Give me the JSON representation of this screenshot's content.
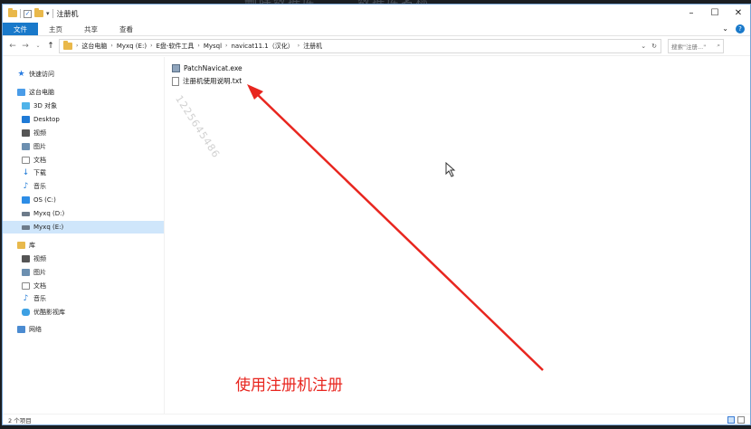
{
  "window": {
    "title": "注册机"
  },
  "ribbon": {
    "tabs": [
      {
        "label": "文件"
      },
      {
        "label": "主页"
      },
      {
        "label": "共享"
      },
      {
        "label": "查看"
      }
    ]
  },
  "address": {
    "crumbs": [
      "这台电脑",
      "Myxq (E:)",
      "E盘-软件工具",
      "Mysql",
      "navicat11.1（汉化）",
      "注册机"
    ],
    "search_placeholder": "搜索\"注册...\""
  },
  "nav_pane": {
    "items": [
      {
        "label": "快速访问",
        "icon": "star-icon"
      },
      {
        "label": "这台电脑",
        "icon": "pc-icon"
      },
      {
        "label": "3D 对象",
        "icon": "3d-objects-icon"
      },
      {
        "label": "Desktop",
        "icon": "desktop-icon"
      },
      {
        "label": "视频",
        "icon": "video-icon"
      },
      {
        "label": "图片",
        "icon": "picture-icon"
      },
      {
        "label": "文档",
        "icon": "document-icon"
      },
      {
        "label": "下载",
        "icon": "download-icon"
      },
      {
        "label": "音乐",
        "icon": "music-icon"
      },
      {
        "label": "OS (C:)",
        "icon": "os-drive-icon"
      },
      {
        "label": "Myxq (D:)",
        "icon": "drive-icon"
      },
      {
        "label": "Myxq (E:)",
        "icon": "drive-icon",
        "selected": true
      },
      {
        "label": "库",
        "icon": "library-icon"
      },
      {
        "label": "视频",
        "icon": "video-icon"
      },
      {
        "label": "图片",
        "icon": "picture-icon"
      },
      {
        "label": "文档",
        "icon": "document-icon"
      },
      {
        "label": "音乐",
        "icon": "music-icon"
      },
      {
        "label": "优酷影视库",
        "icon": "youku-library-icon"
      },
      {
        "label": "网络",
        "icon": "network-icon"
      }
    ]
  },
  "files": [
    {
      "name": "PatchNavicat.exe",
      "icon": "exe-file-icon"
    },
    {
      "name": "注册机使用说明.txt",
      "icon": "txt-file-icon"
    }
  ],
  "watermark": "1225645486",
  "annotation": "使用注册机注册",
  "status": {
    "item_count": "2 个项目"
  },
  "colors": {
    "accent": "#1979ca",
    "annotation": "#e8261f",
    "selection": "#cfe6fb"
  }
}
